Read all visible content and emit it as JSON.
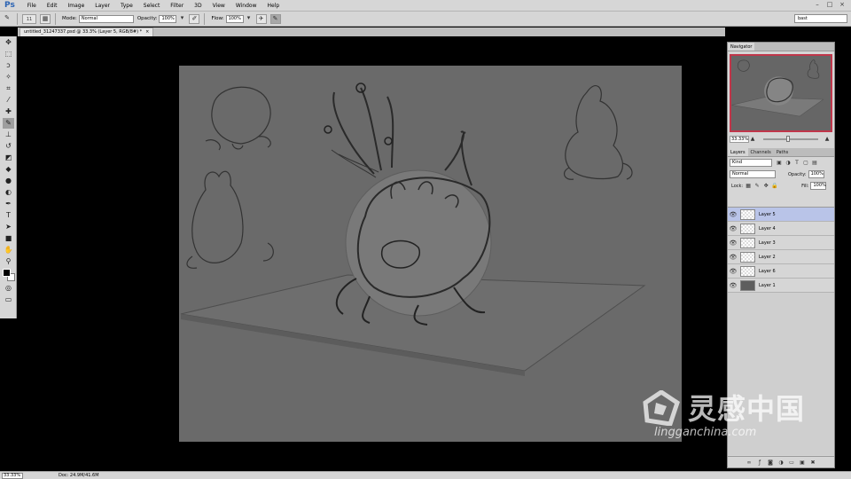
{
  "app": {
    "logo": "Ps",
    "menus": [
      "File",
      "Edit",
      "Image",
      "Layer",
      "Type",
      "Select",
      "Filter",
      "3D",
      "View",
      "Window",
      "Help"
    ],
    "window_buttons": [
      "–",
      "□",
      "×"
    ]
  },
  "options": {
    "brush_size": "11",
    "mode_label": "Mode:",
    "mode_value": "Normal",
    "opacity_label": "Opacity:",
    "opacity_value": "100%",
    "flow_label": "Flow:",
    "flow_value": "100%",
    "workspace": "bast"
  },
  "document": {
    "tab_title": "untitled_31247337.psd @ 33.3% (Layer 5, RGB/8#) *",
    "tab_close": "×"
  },
  "status": {
    "zoom": "33.33%",
    "doc": "Doc: 24.9M/41.6M"
  },
  "navigator": {
    "title": "Navigator",
    "zoom": "33.33%",
    "zoom_fraction": 0.42
  },
  "layers_panel": {
    "tabs": [
      "Layers",
      "Channels",
      "Paths"
    ],
    "filter": "Kind",
    "blend_mode": "Normal",
    "opacity_label": "Opacity:",
    "opacity_value": "100%",
    "lock_label": "Lock:",
    "fill_label": "Fill:",
    "fill_value": "100%",
    "layers": [
      {
        "name": "Layer 5",
        "selected": true,
        "filled": false
      },
      {
        "name": "Layer 4",
        "selected": false,
        "filled": false
      },
      {
        "name": "Layer 3",
        "selected": false,
        "filled": false
      },
      {
        "name": "Layer 2",
        "selected": false,
        "filled": false
      },
      {
        "name": "Layer 6",
        "selected": false,
        "filled": false
      },
      {
        "name": "Layer 1",
        "selected": false,
        "filled": true
      }
    ],
    "footer_icons": [
      "link-icon",
      "fx-icon",
      "mask-icon",
      "adjustment-icon",
      "group-icon",
      "new-layer-icon",
      "trash-icon"
    ]
  },
  "watermark": {
    "chinese": "灵感中国",
    "url": "lingganchina.com"
  },
  "colors": {
    "ui_gray": "#d6d6d6",
    "canvas_bg": "#6a6a6a",
    "selected_layer": "#b9c4e8",
    "navigator_frame": "#c0364a"
  }
}
